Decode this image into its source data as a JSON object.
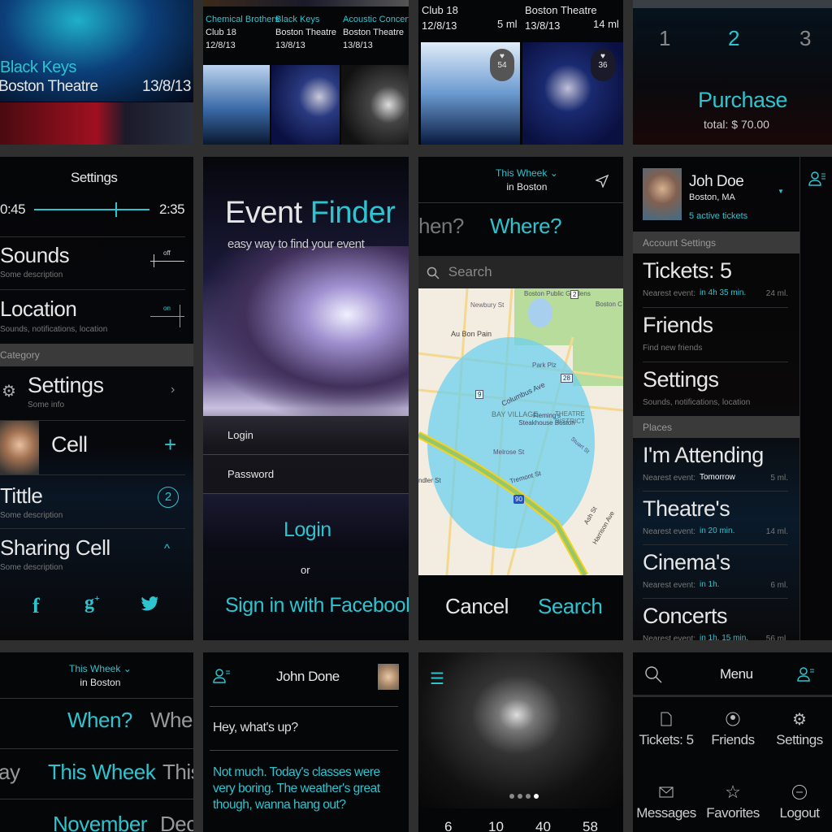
{
  "colors": {
    "accent": "#2ec4cf",
    "background": "#050608",
    "gutter": "#2f2f2f"
  },
  "event_hero": {
    "title": "Black Keys",
    "venue": "Boston Theatre",
    "date": "13/8/13"
  },
  "event_grid": [
    {
      "title": "Chemical Brothers",
      "venue": "Club 18",
      "date": "12/8/13"
    },
    {
      "title": "Black Keys",
      "venue": "Boston Theatre",
      "date": "13/8/13"
    },
    {
      "title": "Acoustic Concert",
      "venue": "Boston Theatre",
      "date": "13/8/13"
    }
  ],
  "event_likes": {
    "items": [
      {
        "venue": "Club 18",
        "date": "12/8/13",
        "distance": "5 ml",
        "likes": "54"
      },
      {
        "venue": "Boston Theatre",
        "date": "13/8/13",
        "distance": "14 ml",
        "likes": "36"
      }
    ]
  },
  "purchase": {
    "quantities": [
      "1",
      "2",
      "3"
    ],
    "selected": "2",
    "button": "Purchase",
    "total": "total: $ 70.00"
  },
  "settings": {
    "title": "Settings",
    "time_start": "0:45",
    "time_end": "2:35",
    "slider_fraction": 0.73,
    "sounds": {
      "label": "Sounds",
      "desc": "Some description",
      "state": "off"
    },
    "location": {
      "label": "Location",
      "desc": "Sounds, notifications, location",
      "state": "on"
    },
    "category_header": "Category",
    "cells": {
      "settings": {
        "label": "Settings",
        "desc": "Some info"
      },
      "cell": {
        "label": "Cell"
      },
      "title": {
        "label": "Tittle",
        "desc": "Some description",
        "badge": "2"
      },
      "sharing": {
        "label": "Sharing Cell",
        "desc": "Some description"
      }
    },
    "social": [
      "facebook",
      "google-plus",
      "twitter"
    ]
  },
  "login": {
    "title_a": "Event",
    "title_b": "Finder",
    "subtitle": "easy way to find your event",
    "login_placeholder": "Login",
    "password_placeholder": "Password",
    "login_button": "Login",
    "or": "or",
    "facebook_button": "Sign in with Facebook"
  },
  "map_screen": {
    "period": "This Wheek",
    "city": "in Boston",
    "tab_prev": "hen?",
    "tab_active": "Where?",
    "search_placeholder": "Search",
    "labels": [
      "Boston Public Gardens",
      "Newbury St",
      "Au Bon Pain",
      "Park Plz",
      "Columbus Ave",
      "BAY VILLAGE",
      "Fleming's Steakhouse Boston",
      "THEATRE DISTRICT",
      "Melrose St",
      "Tremont St",
      "Stuart St",
      "Ash St",
      "Harrison Ave",
      "Boston C",
      "ndler St",
      "2",
      "28",
      "9",
      "90"
    ],
    "cancel": "Cancel",
    "search": "Search"
  },
  "profile": {
    "name": "Joh Doe",
    "location": "Boston, MA",
    "tickets": "5 active tickets",
    "account_header": "Account Settings",
    "places_header": "Places",
    "account_items": [
      {
        "label": "Tickets: 5",
        "sub": "Nearest event:",
        "time": "in 4h 35 min.",
        "dist": "24 ml."
      },
      {
        "label": "Friends",
        "sub": "Find new friends"
      },
      {
        "label": "Settings",
        "sub": "Sounds, notifications, location"
      }
    ],
    "places": [
      {
        "label": "I'm Attending",
        "sub": "Nearest event:",
        "time": "Tomorrow",
        "dist": "5 ml."
      },
      {
        "label": "Theatre's",
        "sub": "Nearest event:",
        "time": "in 20 min.",
        "dist": "14 ml."
      },
      {
        "label": "Cinema's",
        "sub": "Nearest event:",
        "time": "in 1h.",
        "dist": "6 ml."
      },
      {
        "label": "Concerts",
        "sub": "Nearest event:",
        "time": "in 1h. 15 min.",
        "dist": "56 ml."
      }
    ]
  },
  "picker": {
    "period": "This Wheek",
    "city": "in Boston",
    "row1": [
      "When?",
      "When"
    ],
    "row2": [
      "ay",
      "This Wheek",
      "This"
    ],
    "row3": [
      "November",
      "Dec"
    ]
  },
  "chat": {
    "name": "John Done",
    "message": "Hey, what's up?",
    "reply": "Not much. Today's classes were very boring. The weather's great though, wanna hang out?"
  },
  "gallery": {
    "page_dots": 4,
    "active_dot": 4,
    "counts": [
      "6",
      "10",
      "40",
      "58"
    ]
  },
  "menu": {
    "title": "Menu",
    "items": [
      {
        "icon": "ticket",
        "label": "Tickets: 5"
      },
      {
        "icon": "friends",
        "label": "Friends"
      },
      {
        "icon": "gear",
        "label": "Settings"
      },
      {
        "icon": "envelope",
        "label": "Messages"
      },
      {
        "icon": "star",
        "label": "Favorites"
      },
      {
        "icon": "logout",
        "label": "Logout"
      }
    ]
  }
}
